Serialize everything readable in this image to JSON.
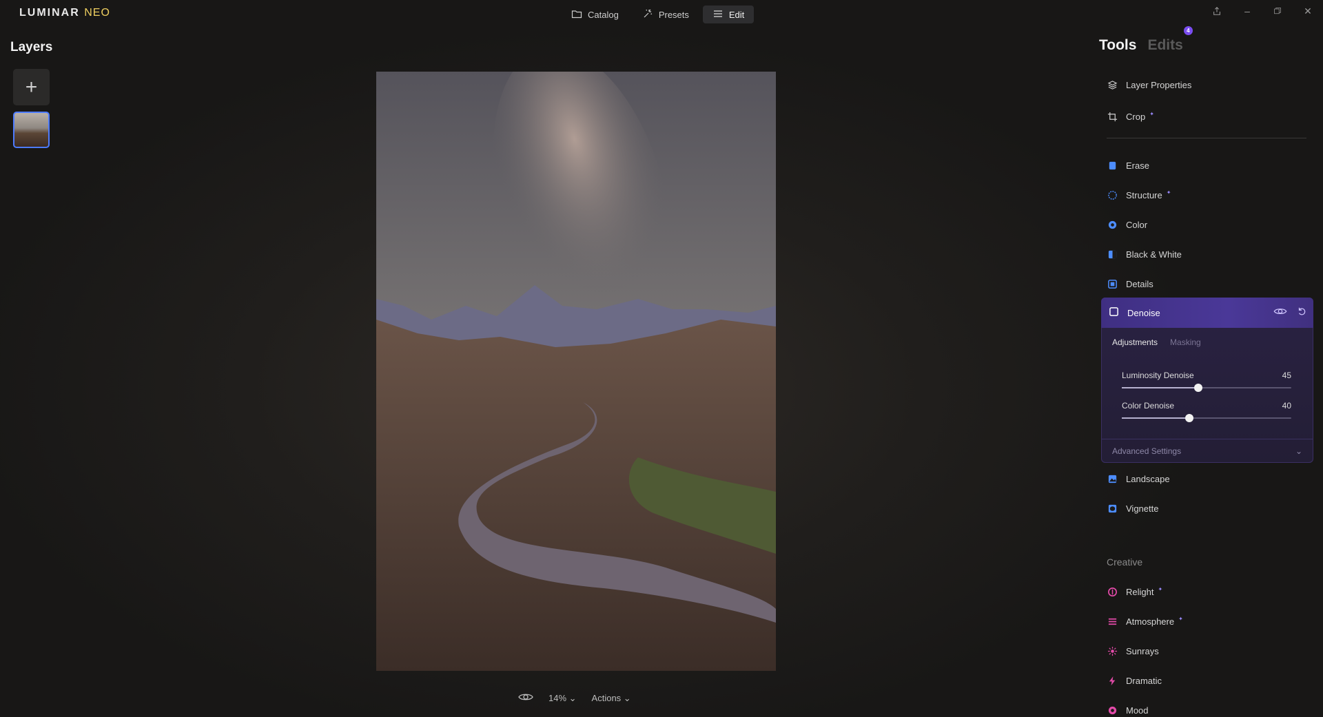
{
  "app": {
    "logo_main": "LUMINAR",
    "logo_sub": "NEO"
  },
  "modes": [
    {
      "label": "Catalog",
      "icon": "folder-icon"
    },
    {
      "label": "Presets",
      "icon": "presets-icon"
    },
    {
      "label": "Edit",
      "icon": "sliders-icon",
      "active": true
    }
  ],
  "window_controls": [
    "share-icon",
    "minimize-icon",
    "restore-icon",
    "close-icon"
  ],
  "layers": {
    "title": "Layers",
    "add_label": "+"
  },
  "bottom": {
    "zoom": "14%",
    "actions": "Actions"
  },
  "panel": {
    "tab_tools": "Tools",
    "tab_edits": "Edits",
    "edits_badge": "4",
    "tools_top": [
      "Layer Properties",
      "Crop"
    ],
    "tools_essentials": [
      "Erase",
      "Structure",
      "Color",
      "Black & White",
      "Details"
    ],
    "denoise": {
      "title": "Denoise",
      "tab_adjustments": "Adjustments",
      "tab_masking": "Masking",
      "luminosity_label": "Luminosity Denoise",
      "luminosity_value": "45",
      "luminosity_fraction": 0.45,
      "color_label": "Color Denoise",
      "color_value": "40",
      "color_fraction": 0.4,
      "advanced": "Advanced Settings"
    },
    "tools_after": [
      "Landscape",
      "Vignette"
    ],
    "creative_title": "Creative",
    "tools_creative": [
      "Relight",
      "Atmosphere",
      "Sunrays",
      "Dramatic",
      "Mood"
    ]
  },
  "colors": {
    "accent": "#4a3898",
    "blue_icon": "#4d8dff",
    "pink_icon": "#e24aa8"
  }
}
